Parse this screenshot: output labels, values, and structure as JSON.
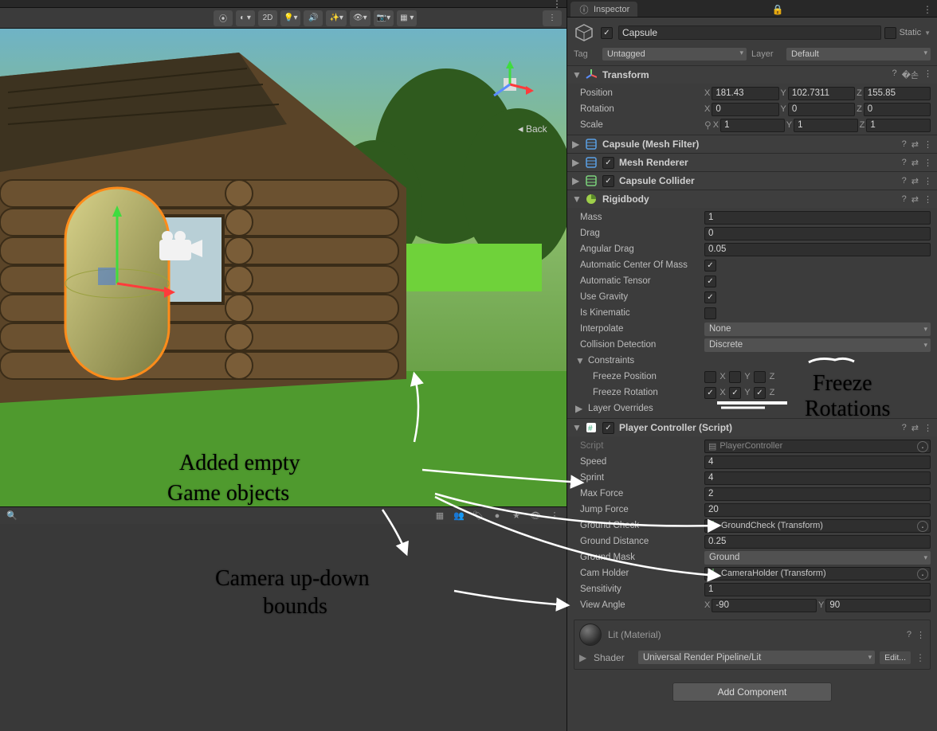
{
  "inspector": {
    "tabLabel": "Inspector",
    "gameObject": {
      "enabled": true,
      "name": "Capsule",
      "staticLabel": "Static",
      "tagLabel": "Tag",
      "tagValue": "Untagged",
      "layerLabel": "Layer",
      "layerValue": "Default"
    },
    "transform": {
      "title": "Transform",
      "position": {
        "label": "Position",
        "x": "181.43",
        "y": "102.7311",
        "z": "155.85"
      },
      "rotation": {
        "label": "Rotation",
        "x": "0",
        "y": "0",
        "z": "0"
      },
      "scale": {
        "label": "Scale",
        "x": "1",
        "y": "1",
        "z": "1"
      }
    },
    "collapsed": [
      {
        "title": "Capsule (Mesh Filter)",
        "iconColor": "#5aa0e6",
        "checkbox": false
      },
      {
        "title": "Mesh Renderer",
        "iconColor": "#5aa0e6",
        "checkbox": true,
        "checked": true
      },
      {
        "title": "Capsule Collider",
        "iconColor": "#7bd47b",
        "checkbox": true,
        "checked": true
      }
    ],
    "rigidbody": {
      "title": "Rigidbody",
      "mass": {
        "label": "Mass",
        "value": "1"
      },
      "drag": {
        "label": "Drag",
        "value": "0"
      },
      "angularDrag": {
        "label": "Angular Drag",
        "value": "0.05"
      },
      "autoCOM": {
        "label": "Automatic Center Of Mass",
        "value": true
      },
      "autoTensor": {
        "label": "Automatic Tensor",
        "value": true
      },
      "useGravity": {
        "label": "Use Gravity",
        "value": true
      },
      "isKinematic": {
        "label": "Is Kinematic",
        "value": false
      },
      "interpolate": {
        "label": "Interpolate",
        "value": "None"
      },
      "collision": {
        "label": "Collision Detection",
        "value": "Discrete"
      },
      "constraintsLabel": "Constraints",
      "freezePos": {
        "label": "Freeze Position",
        "x": false,
        "y": false,
        "z": false
      },
      "freezeRot": {
        "label": "Freeze Rotation",
        "x": true,
        "y": true,
        "z": true
      },
      "layerOverrides": "Layer Overrides"
    },
    "script": {
      "title": "Player Controller (Script)",
      "scriptLabel": "Script",
      "scriptValue": "PlayerController",
      "speed": {
        "label": "Speed",
        "value": "4"
      },
      "sprint": {
        "label": "Sprint",
        "value": "4"
      },
      "maxForce": {
        "label": "Max Force",
        "value": "2"
      },
      "jumpForce": {
        "label": "Jump Force",
        "value": "20"
      },
      "groundCheck": {
        "label": "Ground Check",
        "value": "GroundCheck (Transform)"
      },
      "groundDistance": {
        "label": "Ground Distance",
        "value": "0.25"
      },
      "groundMask": {
        "label": "Ground Mask",
        "value": "Ground"
      },
      "camHolder": {
        "label": "Cam Holder",
        "value": "CameraHolder (Transform)"
      },
      "sensitivity": {
        "label": "Sensitivity",
        "value": "1"
      },
      "viewAngle": {
        "label": "View Angle",
        "x": "-90",
        "y": "90"
      }
    },
    "material": {
      "name": "Lit (Material)",
      "shaderLabel": "Shader",
      "shaderValue": "Universal Render Pipeline/Lit",
      "editLabel": "Edit..."
    },
    "addComponent": "Add Component"
  },
  "sceneToolbar": {
    "shading": "⬤▾",
    "mode2d": "2D",
    "backLabel": "Back"
  },
  "annotations": {
    "a1_line1": "Added empty",
    "a1_line2": "Game objects",
    "a2_line1": "Camera up-down",
    "a2_line2": "bounds",
    "a3_line1": "Freeze",
    "a3_line2": "Rotations"
  }
}
